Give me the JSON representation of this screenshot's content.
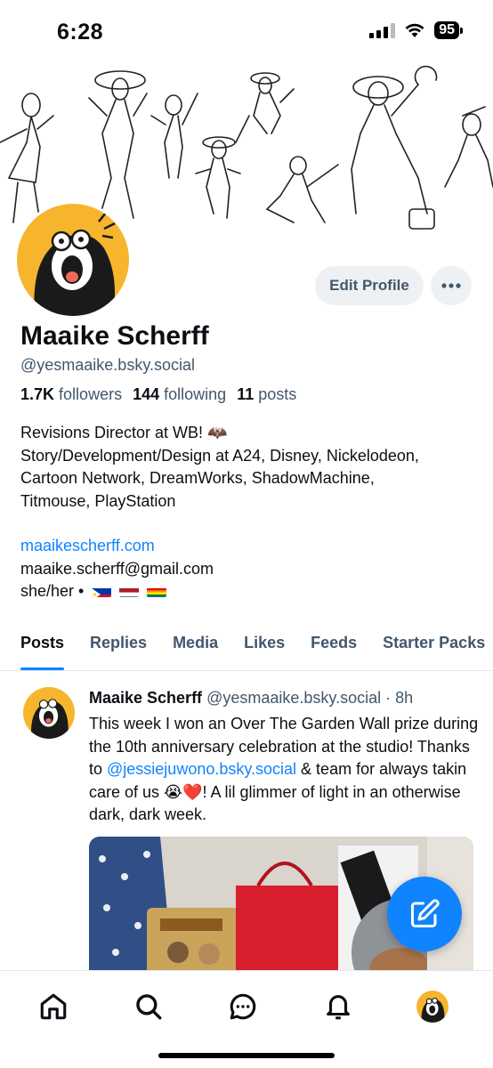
{
  "status_bar": {
    "time": "6:28",
    "battery": "95"
  },
  "profile": {
    "display_name": "Maaike Scherff",
    "handle": "@yesmaaike.bsky.social",
    "edit_label": "Edit Profile",
    "more_label": "•••",
    "stats": {
      "followers_count": "1.7K",
      "followers_label": "followers",
      "following_count": "144",
      "following_label": "following",
      "posts_count": "11",
      "posts_label": "posts"
    },
    "bio": {
      "line1": "Revisions Director at WB! 🦇",
      "line2": "Story/Development/Design at A24, Disney, Nickelodeon,",
      "line3": "Cartoon Network, DreamWorks, ShadowMachine,",
      "line4": "Titmouse, PlayStation",
      "link": "maaikescherff.com",
      "email": "maaike.scherff@gmail.com",
      "pronouns": "she/her •"
    }
  },
  "tabs": [
    "Posts",
    "Replies",
    "Media",
    "Likes",
    "Feeds",
    "Starter Packs"
  ],
  "post": {
    "author": "Maaike Scherff",
    "handle": "@yesmaaike.bsky.social",
    "separator": "·",
    "time": "8h",
    "text_a": "This week I won an Over The Garden Wall prize during the 10th anniversary celebration at the studio! Thanks to ",
    "mention": "@jessiejuwono.bsky.social",
    "text_b": " & team for always takin care of us 😭❤️! A lil glimmer of light in an otherwise dark, dark week."
  },
  "colors": {
    "accent": "#1083fe",
    "secondary_text": "#42576c",
    "avatar_bg": "#f6b52d"
  },
  "icons": [
    "home-icon",
    "search-icon",
    "chat-icon",
    "bell-icon",
    "compose-icon"
  ]
}
